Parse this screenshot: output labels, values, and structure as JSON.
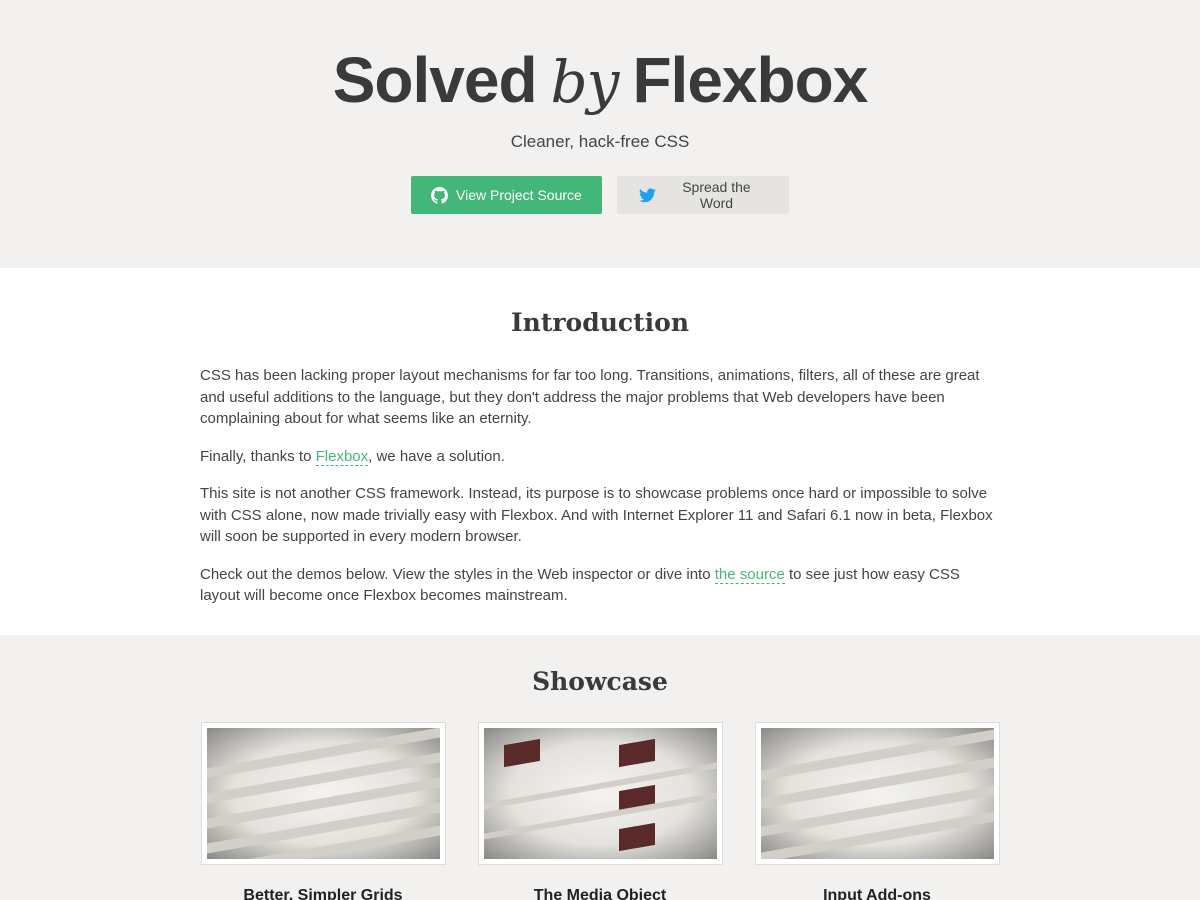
{
  "hero": {
    "title_part1": "Solved",
    "title_by": "by",
    "title_part2": "Flexbox",
    "subtitle": "Cleaner, hack-free CSS",
    "btn_source_label": "View Project Source",
    "btn_source_icon": "github-icon",
    "btn_share_label": "Spread the Word",
    "btn_share_icon": "twitter-icon"
  },
  "intro": {
    "heading": "Introduction",
    "p1": "CSS has been lacking proper layout mechanisms for far too long. Transitions, animations, filters, all of these are great and useful additions to the language, but they don't address the major problems that Web developers have been complaining about for what seems like an eternity.",
    "p2_before": "Finally, thanks to ",
    "p2_link": "Flexbox",
    "p2_after": ", we have a solution.",
    "p3": "This site is not another CSS framework. Instead, its purpose is to showcase problems once hard or impossible to solve with CSS alone, now made trivially easy with Flexbox. And with Internet Explorer 11 and Safari 6.1 now in beta, Flexbox will soon be supported in every modern browser.",
    "p4_before": "Check out the demos below. View the styles in the Web inspector or dive into ",
    "p4_link": "the source",
    "p4_after": " to see just how easy CSS layout will become once Flexbox becomes mainstream."
  },
  "showcase": {
    "heading": "Showcase",
    "cards": [
      {
        "label": "Better, Simpler Grids"
      },
      {
        "label": "The Media Object"
      },
      {
        "label": "Input Add-ons"
      }
    ]
  },
  "colors": {
    "accent": "#43b77a",
    "hero_bg": "#f2f1ef",
    "twitter": "#1da1f2"
  }
}
